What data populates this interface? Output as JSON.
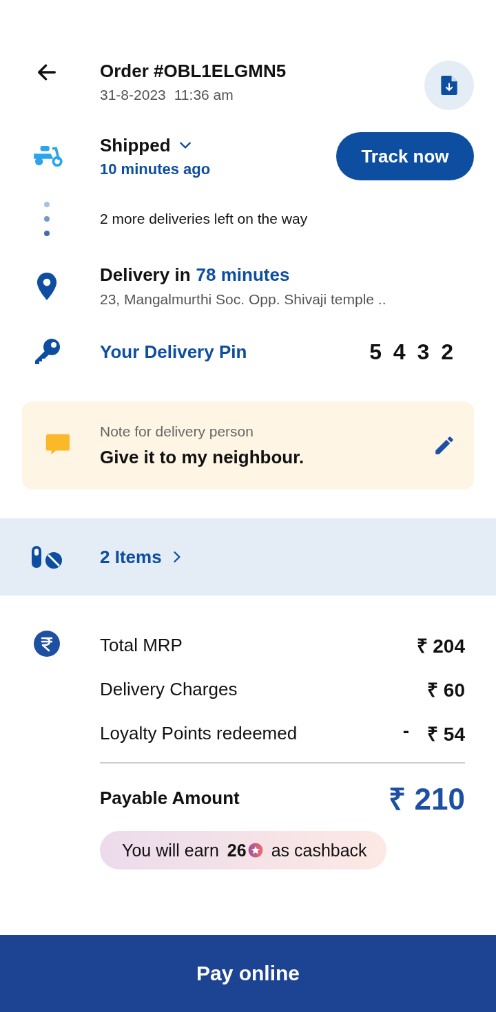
{
  "order": {
    "title": "Order #OBL1ELGMN5",
    "date": "31-8-2023",
    "time": "11:36 am"
  },
  "status": {
    "label": "Shipped",
    "time_ago": "10 minutes ago",
    "action": "Track now"
  },
  "queue_note": "2 more deliveries left on the way",
  "delivery": {
    "prefix": "Delivery in",
    "eta": "78 minutes",
    "address": "23, Mangalmurthi Soc. Opp. Shivaji temple .."
  },
  "pin": {
    "label": "Your Delivery Pin",
    "value": "5 4 3 2"
  },
  "note": {
    "label": "Note for delivery person",
    "text": "Give it to my neighbour."
  },
  "items": {
    "label": "2 Items"
  },
  "bill": {
    "rows": [
      {
        "label": "Total MRP",
        "sign": "",
        "amount": "₹ 204"
      },
      {
        "label": "Delivery Charges",
        "sign": "",
        "amount": "₹ 60"
      },
      {
        "label": "Loyalty Points redeemed",
        "sign": "-",
        "amount": "₹ 54"
      }
    ],
    "total_label": "Payable Amount",
    "total": "₹ 210"
  },
  "cashback": {
    "prefix": "You will earn",
    "points": "26",
    "suffix": "as cashback"
  },
  "pay_button": "Pay online"
}
